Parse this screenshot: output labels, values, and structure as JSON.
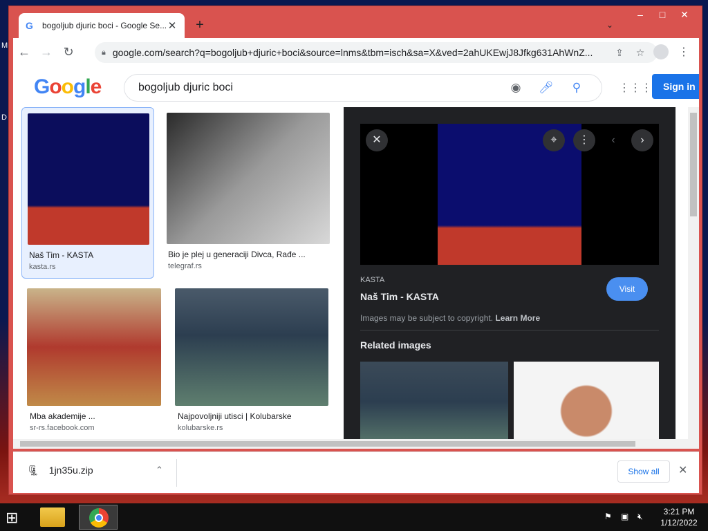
{
  "desktop": {
    "labels": [
      "M",
      "D"
    ]
  },
  "browser": {
    "tab_title": "bogoljub djuric boci - Google Se...",
    "tab_favicon": "G",
    "new_tab": "+",
    "url": "google.com/search?q=bogoljub+djuric+boci&source=lnms&tbm=isch&sa=X&ved=2ahUKEwjJ8Jfkg631AhWnZ..."
  },
  "google": {
    "logo": "Google",
    "logo_colors": [
      "#4285f4",
      "#ea4335",
      "#fbbc05",
      "#4285f4",
      "#34a853",
      "#ea4335"
    ],
    "query": "bogoljub djuric boci",
    "sign_in": "Sign in"
  },
  "results": [
    {
      "caption": "Naš Tim - KASTA",
      "source": "kasta.rs"
    },
    {
      "caption": "Bio je plej u generaciji Divca, Rađe ...",
      "source": "telegraf.rs"
    },
    {
      "caption": "Mba akademije ...",
      "source": "sr-rs.facebook.com"
    },
    {
      "caption": "Najpovoljniji utisci | Kolubarske",
      "source": "kolubarske.rs"
    }
  ],
  "panel": {
    "site": "KASTA",
    "title": "Naš Tim - KASTA",
    "visit": "Visit",
    "copyright_text": "Images may be subject to copyright.",
    "learn_more": "Learn More",
    "related_heading": "Related images"
  },
  "downloads": {
    "file_name": "1jn35u.zip",
    "show_all": "Show all"
  },
  "taskbar": {
    "time": "3:21 PM",
    "date": "1/12/2022"
  }
}
